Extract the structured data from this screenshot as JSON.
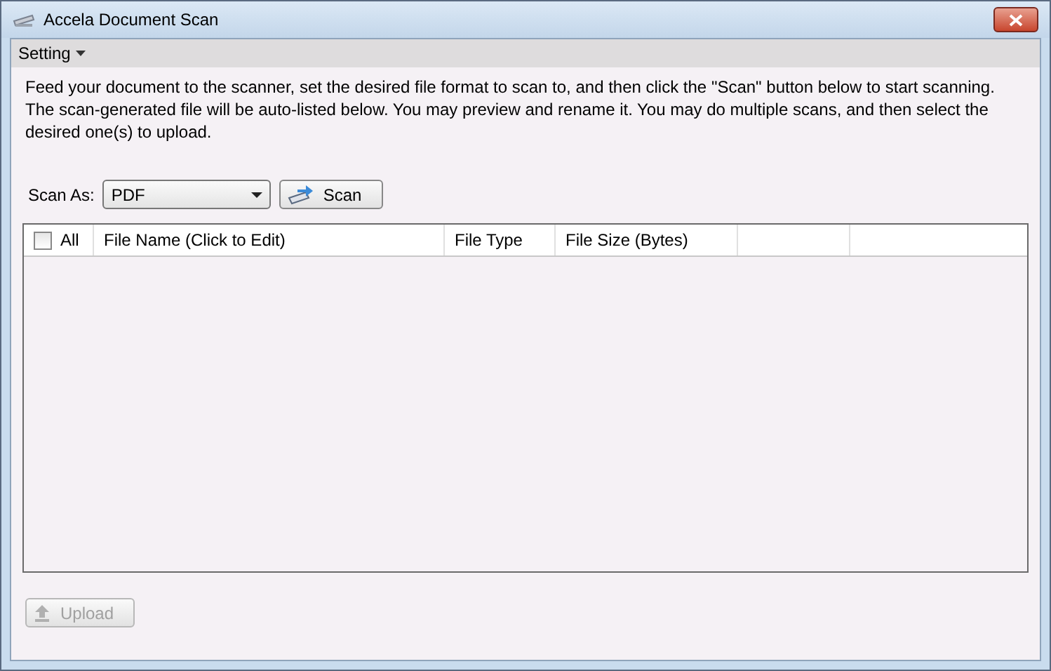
{
  "window": {
    "title": "Accela Document Scan"
  },
  "menu": [
    {
      "label": "Setting"
    }
  ],
  "instructions": "Feed your document to the scanner, set the desired file format to scan to, and then click the \"Scan\" button below to start scanning. The scan-generated file will be auto-listed below. You may preview and rename it. You may do multiple scans, and then select the desired one(s) to upload.",
  "scan_as": {
    "label": "Scan As:",
    "value": "PDF"
  },
  "scan_button": {
    "label": "Scan"
  },
  "table": {
    "select_all": {
      "label": "All",
      "checked": false
    },
    "columns": [
      "File Name (Click to Edit)",
      "File Type",
      "File Size (Bytes)"
    ]
  },
  "upload_button": {
    "label": "Upload",
    "disabled": true
  }
}
